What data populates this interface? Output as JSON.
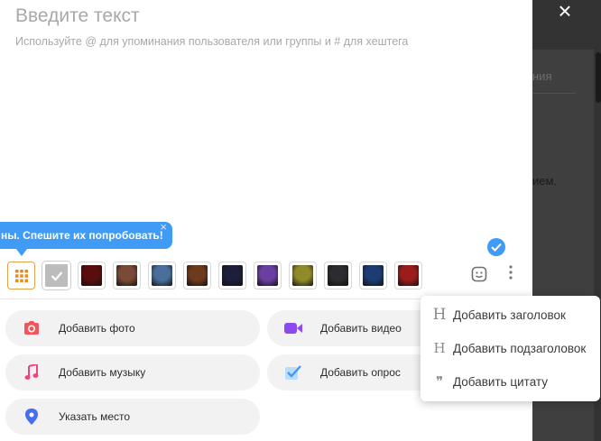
{
  "background_page": {
    "tab_fragment": "ния",
    "text_fragment": "ием."
  },
  "editor": {
    "title_placeholder": "Введите текст",
    "hint": "Используйте @ для упоминания пользователя или группы и # для хештега"
  },
  "tooltip": {
    "text": "ны. Спешите их попробовать!",
    "close_glyph": "×"
  },
  "close_glyph": "×",
  "backgrounds": [
    {
      "name": "grid",
      "color": "#e58a1f"
    },
    {
      "name": "plain-grey",
      "color": "#bcbcbc"
    },
    {
      "name": "dark-red",
      "color": "#5a0d0d"
    },
    {
      "name": "warrior-brown",
      "color": "#7a4a36"
    },
    {
      "name": "ice-blue",
      "color": "#4a6f9a"
    },
    {
      "name": "fire-brown",
      "color": "#6e3a1c"
    },
    {
      "name": "dark-suit",
      "color": "#1c1e3a"
    },
    {
      "name": "purple",
      "color": "#6a3fa0"
    },
    {
      "name": "olive",
      "color": "#8f8a2a"
    },
    {
      "name": "dark-grey",
      "color": "#2b2b30"
    },
    {
      "name": "neon-blue",
      "color": "#1d3c73"
    },
    {
      "name": "crimson",
      "color": "#9a1c1c"
    }
  ],
  "actions": [
    {
      "id": "photo",
      "label": "Добавить фото",
      "color": "#f2545b"
    },
    {
      "id": "video",
      "label": "Добавить видео",
      "color": "#8a4af0"
    },
    {
      "id": "music",
      "label": "Добавить музыку",
      "color": "#f2437a"
    },
    {
      "id": "poll",
      "label": "Добавить опрос",
      "color": "#3f9bf6"
    },
    {
      "id": "place",
      "label": "Указать место",
      "color": "#4a6cf2"
    }
  ],
  "menu": [
    {
      "icon": "H",
      "label": "Добавить заголовок"
    },
    {
      "icon": "H",
      "label": "Добавить подзаголовок"
    },
    {
      "icon": "❞",
      "label": "Добавить цитату"
    }
  ],
  "colors": {
    "accent": "#3f9bf6",
    "overlay": "#3a3a3a"
  }
}
